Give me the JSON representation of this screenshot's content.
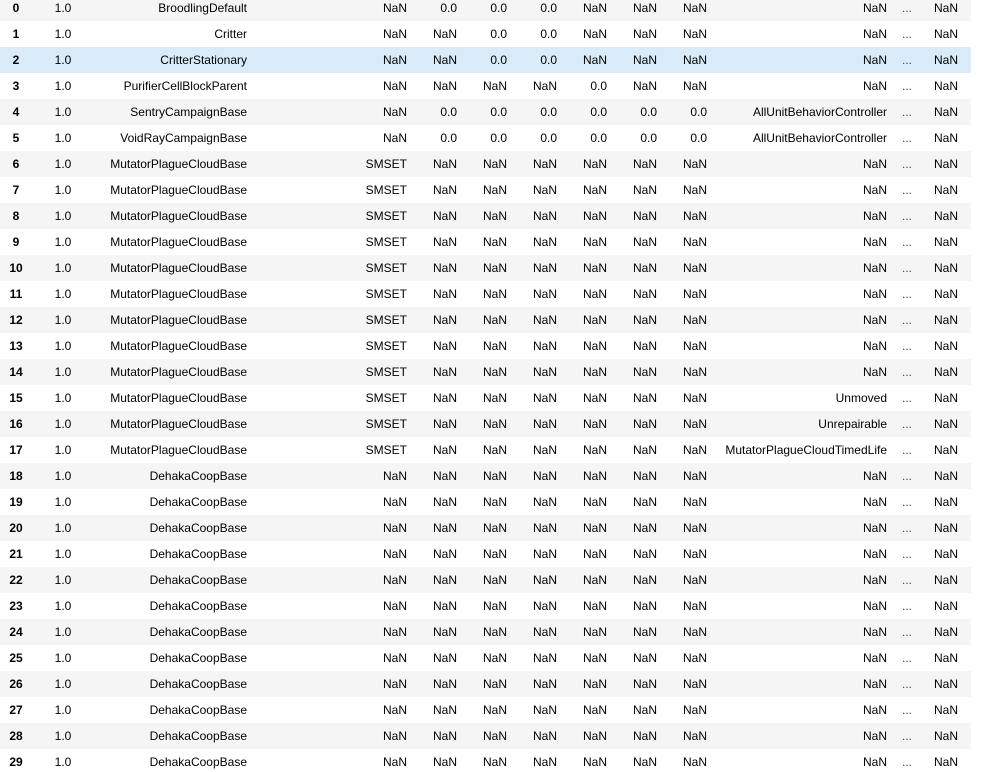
{
  "selected_row_index": 2,
  "colors": {
    "row_odd": "#f5f5f5",
    "row_even": "#ffffff",
    "row_selected": "#d9ebf8"
  },
  "rows": [
    [
      "0",
      "1.0",
      "BroodlingDefault",
      "NaN",
      "0.0",
      "0.0",
      "0.0",
      "NaN",
      "NaN",
      "NaN",
      "NaN",
      "...",
      "NaN"
    ],
    [
      "1",
      "1.0",
      "Critter",
      "NaN",
      "NaN",
      "0.0",
      "0.0",
      "NaN",
      "NaN",
      "NaN",
      "NaN",
      "...",
      "NaN"
    ],
    [
      "2",
      "1.0",
      "CritterStationary",
      "NaN",
      "NaN",
      "0.0",
      "0.0",
      "NaN",
      "NaN",
      "NaN",
      "NaN",
      "...",
      "NaN"
    ],
    [
      "3",
      "1.0",
      "PurifierCellBlockParent",
      "NaN",
      "NaN",
      "NaN",
      "NaN",
      "0.0",
      "NaN",
      "NaN",
      "NaN",
      "...",
      "NaN"
    ],
    [
      "4",
      "1.0",
      "SentryCampaignBase",
      "NaN",
      "0.0",
      "0.0",
      "0.0",
      "0.0",
      "0.0",
      "0.0",
      "AllUnitBehaviorController",
      "...",
      "NaN"
    ],
    [
      "5",
      "1.0",
      "VoidRayCampaignBase",
      "NaN",
      "0.0",
      "0.0",
      "0.0",
      "0.0",
      "0.0",
      "0.0",
      "AllUnitBehaviorController",
      "...",
      "NaN"
    ],
    [
      "6",
      "1.0",
      "MutatorPlagueCloudBase",
      "SMSET",
      "NaN",
      "NaN",
      "NaN",
      "NaN",
      "NaN",
      "NaN",
      "NaN",
      "...",
      "NaN"
    ],
    [
      "7",
      "1.0",
      "MutatorPlagueCloudBase",
      "SMSET",
      "NaN",
      "NaN",
      "NaN",
      "NaN",
      "NaN",
      "NaN",
      "NaN",
      "...",
      "NaN"
    ],
    [
      "8",
      "1.0",
      "MutatorPlagueCloudBase",
      "SMSET",
      "NaN",
      "NaN",
      "NaN",
      "NaN",
      "NaN",
      "NaN",
      "NaN",
      "...",
      "NaN"
    ],
    [
      "9",
      "1.0",
      "MutatorPlagueCloudBase",
      "SMSET",
      "NaN",
      "NaN",
      "NaN",
      "NaN",
      "NaN",
      "NaN",
      "NaN",
      "...",
      "NaN"
    ],
    [
      "10",
      "1.0",
      "MutatorPlagueCloudBase",
      "SMSET",
      "NaN",
      "NaN",
      "NaN",
      "NaN",
      "NaN",
      "NaN",
      "NaN",
      "...",
      "NaN"
    ],
    [
      "11",
      "1.0",
      "MutatorPlagueCloudBase",
      "SMSET",
      "NaN",
      "NaN",
      "NaN",
      "NaN",
      "NaN",
      "NaN",
      "NaN",
      "...",
      "NaN"
    ],
    [
      "12",
      "1.0",
      "MutatorPlagueCloudBase",
      "SMSET",
      "NaN",
      "NaN",
      "NaN",
      "NaN",
      "NaN",
      "NaN",
      "NaN",
      "...",
      "NaN"
    ],
    [
      "13",
      "1.0",
      "MutatorPlagueCloudBase",
      "SMSET",
      "NaN",
      "NaN",
      "NaN",
      "NaN",
      "NaN",
      "NaN",
      "NaN",
      "...",
      "NaN"
    ],
    [
      "14",
      "1.0",
      "MutatorPlagueCloudBase",
      "SMSET",
      "NaN",
      "NaN",
      "NaN",
      "NaN",
      "NaN",
      "NaN",
      "NaN",
      "...",
      "NaN"
    ],
    [
      "15",
      "1.0",
      "MutatorPlagueCloudBase",
      "SMSET",
      "NaN",
      "NaN",
      "NaN",
      "NaN",
      "NaN",
      "NaN",
      "Unmoved",
      "...",
      "NaN"
    ],
    [
      "16",
      "1.0",
      "MutatorPlagueCloudBase",
      "SMSET",
      "NaN",
      "NaN",
      "NaN",
      "NaN",
      "NaN",
      "NaN",
      "Unrepairable",
      "...",
      "NaN"
    ],
    [
      "17",
      "1.0",
      "MutatorPlagueCloudBase",
      "SMSET",
      "NaN",
      "NaN",
      "NaN",
      "NaN",
      "NaN",
      "NaN",
      "MutatorPlagueCloudTimedLife",
      "...",
      "NaN"
    ],
    [
      "18",
      "1.0",
      "DehakaCoopBase",
      "NaN",
      "NaN",
      "NaN",
      "NaN",
      "NaN",
      "NaN",
      "NaN",
      "NaN",
      "...",
      "NaN"
    ],
    [
      "19",
      "1.0",
      "DehakaCoopBase",
      "NaN",
      "NaN",
      "NaN",
      "NaN",
      "NaN",
      "NaN",
      "NaN",
      "NaN",
      "...",
      "NaN"
    ],
    [
      "20",
      "1.0",
      "DehakaCoopBase",
      "NaN",
      "NaN",
      "NaN",
      "NaN",
      "NaN",
      "NaN",
      "NaN",
      "NaN",
      "...",
      "NaN"
    ],
    [
      "21",
      "1.0",
      "DehakaCoopBase",
      "NaN",
      "NaN",
      "NaN",
      "NaN",
      "NaN",
      "NaN",
      "NaN",
      "NaN",
      "...",
      "NaN"
    ],
    [
      "22",
      "1.0",
      "DehakaCoopBase",
      "NaN",
      "NaN",
      "NaN",
      "NaN",
      "NaN",
      "NaN",
      "NaN",
      "NaN",
      "...",
      "NaN"
    ],
    [
      "23",
      "1.0",
      "DehakaCoopBase",
      "NaN",
      "NaN",
      "NaN",
      "NaN",
      "NaN",
      "NaN",
      "NaN",
      "NaN",
      "...",
      "NaN"
    ],
    [
      "24",
      "1.0",
      "DehakaCoopBase",
      "NaN",
      "NaN",
      "NaN",
      "NaN",
      "NaN",
      "NaN",
      "NaN",
      "NaN",
      "...",
      "NaN"
    ],
    [
      "25",
      "1.0",
      "DehakaCoopBase",
      "NaN",
      "NaN",
      "NaN",
      "NaN",
      "NaN",
      "NaN",
      "NaN",
      "NaN",
      "...",
      "NaN"
    ],
    [
      "26",
      "1.0",
      "DehakaCoopBase",
      "NaN",
      "NaN",
      "NaN",
      "NaN",
      "NaN",
      "NaN",
      "NaN",
      "NaN",
      "...",
      "NaN"
    ],
    [
      "27",
      "1.0",
      "DehakaCoopBase",
      "NaN",
      "NaN",
      "NaN",
      "NaN",
      "NaN",
      "NaN",
      "NaN",
      "NaN",
      "...",
      "NaN"
    ],
    [
      "28",
      "1.0",
      "DehakaCoopBase",
      "NaN",
      "NaN",
      "NaN",
      "NaN",
      "NaN",
      "NaN",
      "NaN",
      "NaN",
      "...",
      "NaN"
    ],
    [
      "29",
      "1.0",
      "DehakaCoopBase",
      "NaN",
      "NaN",
      "NaN",
      "NaN",
      "NaN",
      "NaN",
      "NaN",
      "NaN",
      "...",
      "NaN"
    ]
  ]
}
